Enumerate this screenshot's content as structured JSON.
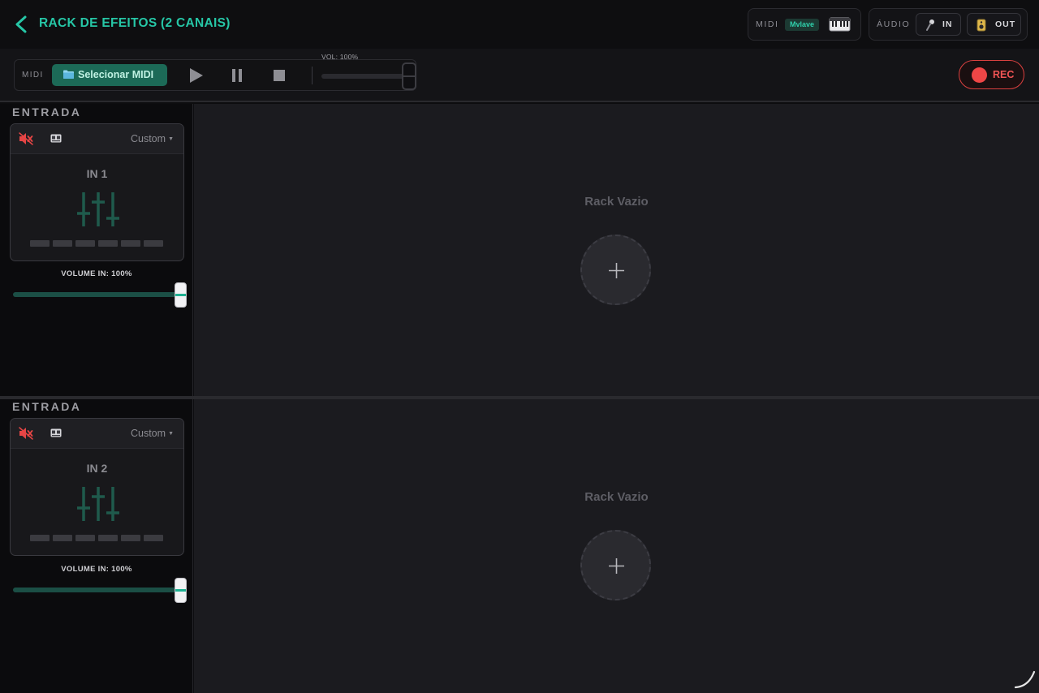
{
  "header": {
    "title": "RACK DE EFEITOS (2 CANAIS)",
    "midi": {
      "label": "MIDI",
      "device": "Mvlave"
    },
    "audio": {
      "label": "ÁUDIO",
      "in_label": "IN",
      "out_label": "OUT"
    }
  },
  "transport": {
    "midi_label": "MIDI",
    "select_midi_label": "Selecionar MIDI",
    "volume_label": "VOL: 100%",
    "volume": 1.0,
    "rec_label": "REC"
  },
  "channels": [
    {
      "section_label": "ENTRADA",
      "preset": "Custom",
      "name": "IN 1",
      "volume_label": "VOLUME IN: 100%",
      "volume": 1.0,
      "muted": true,
      "rack_empty_label": "Rack Vazio"
    },
    {
      "section_label": "ENTRADA",
      "preset": "Custom",
      "name": "IN 2",
      "volume_label": "VOLUME IN: 100%",
      "volume": 1.0,
      "muted": true,
      "rack_empty_label": "Rack Vazio"
    }
  ],
  "colors": {
    "accent": "#26c6a6",
    "rec": "#ef4646",
    "mute": "#e64545",
    "eq_icon": "#1f5a4c"
  },
  "icons": {
    "back": "chevron-left-icon",
    "midi_keyboard": "piano-keyboard-icon",
    "audio_in": "microphone-icon",
    "audio_out": "speaker-icon",
    "select_midi": "folder-icon",
    "play": "play-icon",
    "pause": "pause-icon",
    "stop": "stop-icon",
    "record": "record-dot-icon",
    "mute": "speaker-muted-icon",
    "card": "card-icon",
    "eq": "equalizer-icon",
    "add": "plus-icon"
  }
}
